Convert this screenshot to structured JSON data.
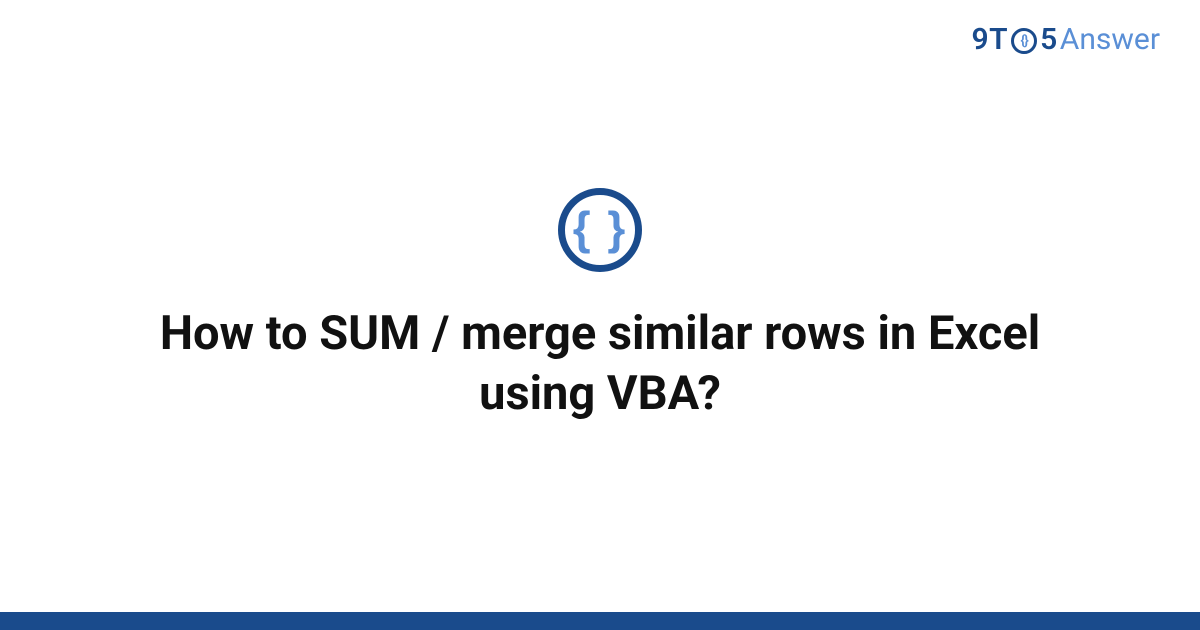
{
  "brand": {
    "prefix": "9T",
    "middle_icon": "braces-icon",
    "suffix": "5",
    "word": "Answer"
  },
  "hero": {
    "icon": "braces-icon",
    "title": "How to SUM / merge similar rows in Excel using VBA?"
  },
  "colors": {
    "primary": "#1a4b8c",
    "accent": "#5a8fd6",
    "text": "#111111",
    "bg": "#ffffff"
  }
}
